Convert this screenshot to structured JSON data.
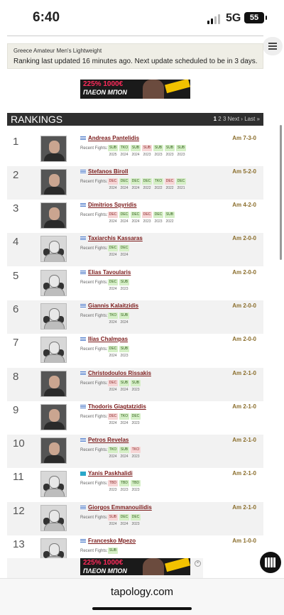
{
  "status_bar": {
    "time": "6:40",
    "network": "5G",
    "battery": "55"
  },
  "info": {
    "title": "Greece Amateur Men's Lightweight",
    "text": "Ranking last updated 16 minutes ago. Next update scheduled to be in 3 days."
  },
  "ad": {
    "headline": "225%",
    "headline_suffix": "1000€",
    "sub": "ΠΛΕΟΝ ΜΠΟΝ"
  },
  "rankings": {
    "title": "RANKINGS",
    "pagination": {
      "current": "1",
      "pages": [
        "2",
        "3"
      ],
      "next": "Next ›",
      "last": "Last »"
    },
    "recent_label": "Recent Fights:",
    "fighters": [
      {
        "rank": "1",
        "name": "Andreas Pantelidis",
        "record": "Am 7-3-0",
        "flag": "gr",
        "photo": "color",
        "fights": [
          {
            "r": "SUB",
            "y": "2025",
            "w": true
          },
          {
            "r": "TKO",
            "y": "2024",
            "w": true
          },
          {
            "r": "SUB",
            "y": "2024",
            "w": true
          },
          {
            "r": "SUB",
            "y": "2023",
            "w": false
          },
          {
            "r": "SUB",
            "y": "2023",
            "w": true
          },
          {
            "r": "SUB",
            "y": "2023",
            "w": true
          },
          {
            "r": "SUB",
            "y": "2023",
            "w": true
          }
        ]
      },
      {
        "rank": "2",
        "name": "Stefanos Biroll",
        "record": "Am 5-2-0",
        "flag": "gr",
        "photo": "color",
        "fights": [
          {
            "r": "DEC",
            "y": "2024",
            "w": false
          },
          {
            "r": "DEC",
            "y": "2024",
            "w": true
          },
          {
            "r": "DEC",
            "y": "2024",
            "w": true
          },
          {
            "r": "DEC",
            "y": "2022",
            "w": true
          },
          {
            "r": "TKO",
            "y": "2022",
            "w": true
          },
          {
            "r": "DEC",
            "y": "2022",
            "w": false
          },
          {
            "r": "DEC",
            "y": "2021",
            "w": true
          }
        ]
      },
      {
        "rank": "3",
        "name": "Dimitrios Spyridis",
        "record": "Am 4-2-0",
        "flag": "gr",
        "photo": "color",
        "fights": [
          {
            "r": "DEC",
            "y": "2024",
            "w": false
          },
          {
            "r": "DEC",
            "y": "2024",
            "w": true
          },
          {
            "r": "DEC",
            "y": "2024",
            "w": true
          },
          {
            "r": "DEC",
            "y": "2023",
            "w": false
          },
          {
            "r": "DEC",
            "y": "2023",
            "w": true
          },
          {
            "r": "SUB",
            "y": "2022",
            "w": true
          }
        ]
      },
      {
        "rank": "4",
        "name": "Taxiarchis Kassaras",
        "record": "Am 2-0-0",
        "flag": "gr",
        "photo": "bw",
        "fights": [
          {
            "r": "DEC",
            "y": "2024",
            "w": true
          },
          {
            "r": "DEC",
            "y": "2024",
            "w": true
          }
        ]
      },
      {
        "rank": "5",
        "name": "Elias Tavoularis",
        "record": "Am 2-0-0",
        "flag": "gr",
        "photo": "bw",
        "fights": [
          {
            "r": "DEC",
            "y": "2024",
            "w": true
          },
          {
            "r": "SUB",
            "y": "2023",
            "w": true
          }
        ]
      },
      {
        "rank": "6",
        "name": "Giannis Kalaitzidis",
        "record": "Am 2-0-0",
        "flag": "gr",
        "photo": "bw",
        "fights": [
          {
            "r": "TKO",
            "y": "2024",
            "w": true
          },
          {
            "r": "SUB",
            "y": "2024",
            "w": true
          }
        ]
      },
      {
        "rank": "7",
        "name": "Ilias Chalmpas",
        "record": "Am 2-0-0",
        "flag": "gr",
        "photo": "bw",
        "fights": [
          {
            "r": "DEC",
            "y": "2024",
            "w": true
          },
          {
            "r": "SUB",
            "y": "2023",
            "w": true
          }
        ]
      },
      {
        "rank": "8",
        "name": "Christodoulos Rissakis",
        "record": "Am 2-1-0",
        "flag": "gr",
        "photo": "color",
        "fights": [
          {
            "r": "DEC",
            "y": "2024",
            "w": false
          },
          {
            "r": "SUB",
            "y": "2024",
            "w": true
          },
          {
            "r": "SUB",
            "y": "2023",
            "w": true
          }
        ]
      },
      {
        "rank": "9",
        "name": "Thodoris Giagtatzidis",
        "record": "Am 2-1-0",
        "flag": "gr",
        "photo": "color",
        "fights": [
          {
            "r": "DEC",
            "y": "2024",
            "w": false
          },
          {
            "r": "TKO",
            "y": "2024",
            "w": true
          },
          {
            "r": "DEC",
            "y": "2023",
            "w": true
          }
        ]
      },
      {
        "rank": "10",
        "name": "Petros Revelas",
        "record": "Am 2-1-0",
        "flag": "gr",
        "photo": "color",
        "fights": [
          {
            "r": "TKO",
            "y": "2024",
            "w": true
          },
          {
            "r": "SUB",
            "y": "2024",
            "w": true
          },
          {
            "r": "TKO",
            "y": "2023",
            "w": false
          }
        ]
      },
      {
        "rank": "11",
        "name": "Yanis Paskhalidi",
        "record": "Am 2-1-0",
        "flag": "kz",
        "photo": "bw",
        "fights": [
          {
            "r": "TBD",
            "y": "2023",
            "w": false
          },
          {
            "r": "TBD",
            "y": "2023",
            "w": true
          },
          {
            "r": "TBD",
            "y": "2023",
            "w": true
          }
        ]
      },
      {
        "rank": "12",
        "name": "Giorgos Emmanouilidis",
        "record": "Am 2-1-0",
        "flag": "gr",
        "photo": "bw",
        "fights": [
          {
            "r": "SUB",
            "y": "2024",
            "w": false
          },
          {
            "r": "DEC",
            "y": "2024",
            "w": true
          },
          {
            "r": "DEC",
            "y": "2023",
            "w": true
          }
        ]
      },
      {
        "rank": "13",
        "name": "Francesko Mpezo",
        "record": "Am 1-0-0",
        "flag": "gr",
        "photo": "bw",
        "fights": [
          {
            "r": "SUB",
            "y": "",
            "w": true
          }
        ]
      }
    ]
  },
  "browser": {
    "url": "tapology.com",
    "ad_close": "×"
  }
}
